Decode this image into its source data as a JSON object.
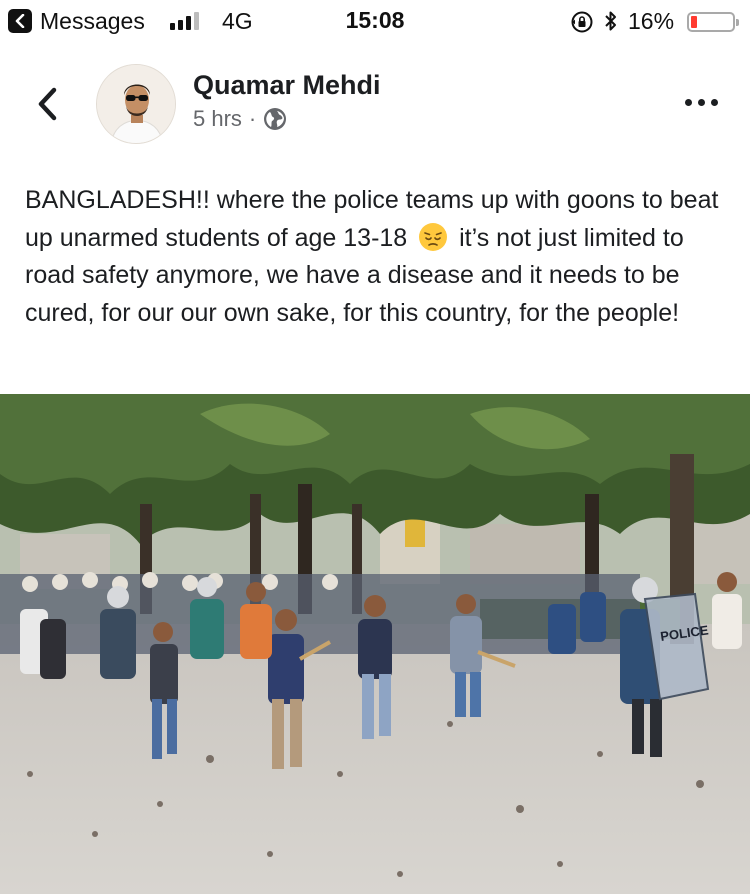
{
  "status_bar": {
    "back_app": "Messages",
    "network": "4G",
    "time": "15:08",
    "battery_percent": "16%",
    "battery_level": 0.16,
    "signal_bars_active": 3,
    "icons": [
      "back-to-app-icon",
      "signal-icon",
      "rotation-lock-icon",
      "bluetooth-icon",
      "battery-icon"
    ]
  },
  "post": {
    "author": "Quamar Mehdi",
    "time_ago": "5 hrs",
    "separator": "·",
    "audience_icon": "globe-icon",
    "text_before_emoji": "BANGLADESH!! where the police teams up with goons to beat up unarmed students of age 13-18",
    "emoji": "pensive-face",
    "text_after_emoji": "it’s not just limited to road safety anymore, we have a disease and it needs to be cured, for our our own sake, for this country, for the people!",
    "photo": {
      "shield_text": "POLICE"
    }
  },
  "colors": {
    "text": "#1c1e21",
    "meta": "#65676b",
    "battery_low": "#ff3b30"
  }
}
